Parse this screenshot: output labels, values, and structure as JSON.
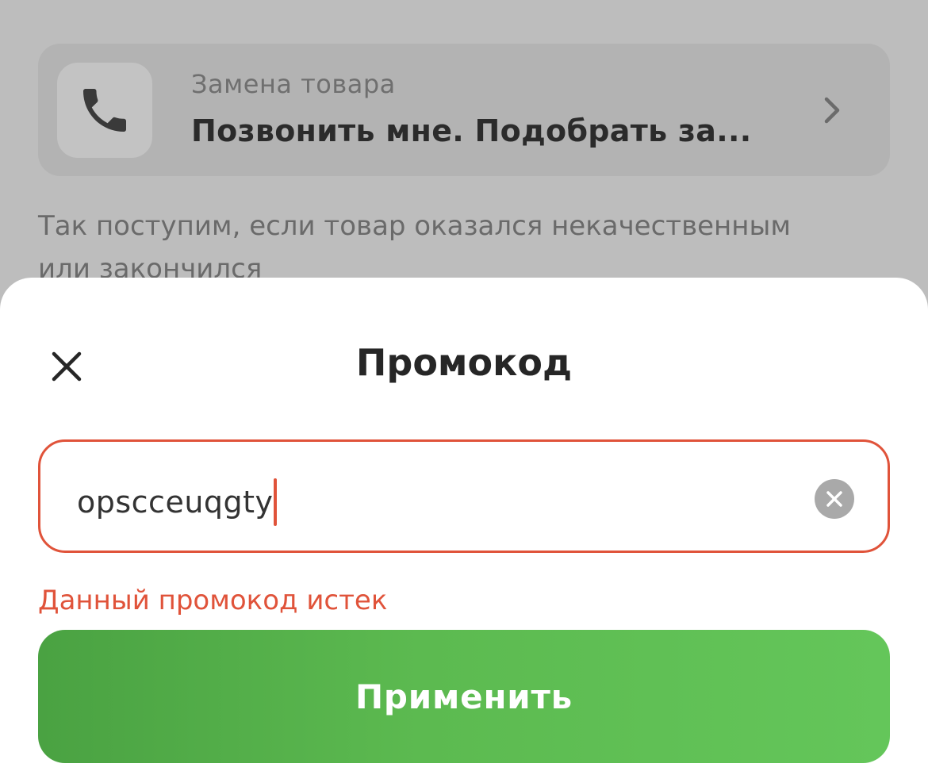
{
  "background": {
    "replacement": {
      "subtitle": "Замена товара",
      "title": "Позвонить мне. Подобрать за..."
    },
    "hint": "Так поступим, если товар оказался некачественным или закончился"
  },
  "sheet": {
    "title": "Промокод",
    "promo_input": {
      "value": "opscceuqgty",
      "state": "error"
    },
    "error": "Данный промокод истек",
    "apply_label": "Применить"
  },
  "colors": {
    "error": "#e0533a",
    "button_start": "#4aa242",
    "button_end": "#64c65a",
    "overlay": "#bdbdbd"
  },
  "icons": {
    "phone": "phone-icon",
    "chevron": "chevron-right-icon",
    "close": "close-icon",
    "clear": "clear-circle-icon"
  }
}
